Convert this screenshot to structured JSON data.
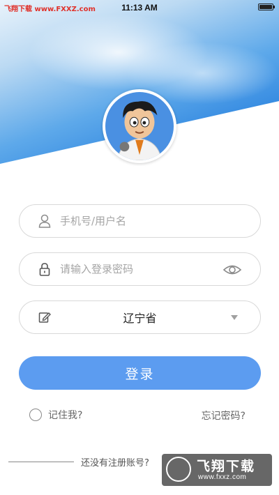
{
  "status_bar": {
    "time": "11:13 AM"
  },
  "watermark_top": {
    "text": "飞翔下载 www.FXXZ.com"
  },
  "login_form": {
    "username": {
      "placeholder": "手机号/用户名",
      "value": ""
    },
    "password": {
      "placeholder": "请输入登录密码",
      "value": ""
    },
    "province": {
      "selected": "辽宁省"
    },
    "login_label": "登录",
    "remember_label": "记住我?",
    "forgot_label": "忘记密码?",
    "register_text": "还没有注册账号?"
  },
  "watermark_bottom": {
    "title": "飞翔下载",
    "url": "www.fxxz.com"
  },
  "colors": {
    "accent": "#5c9cf0",
    "header_blue": "#3b8de6"
  },
  "icons": [
    "user-icon",
    "lock-icon",
    "eye-icon",
    "edit-icon",
    "dropdown-caret-icon",
    "battery-icon"
  ]
}
